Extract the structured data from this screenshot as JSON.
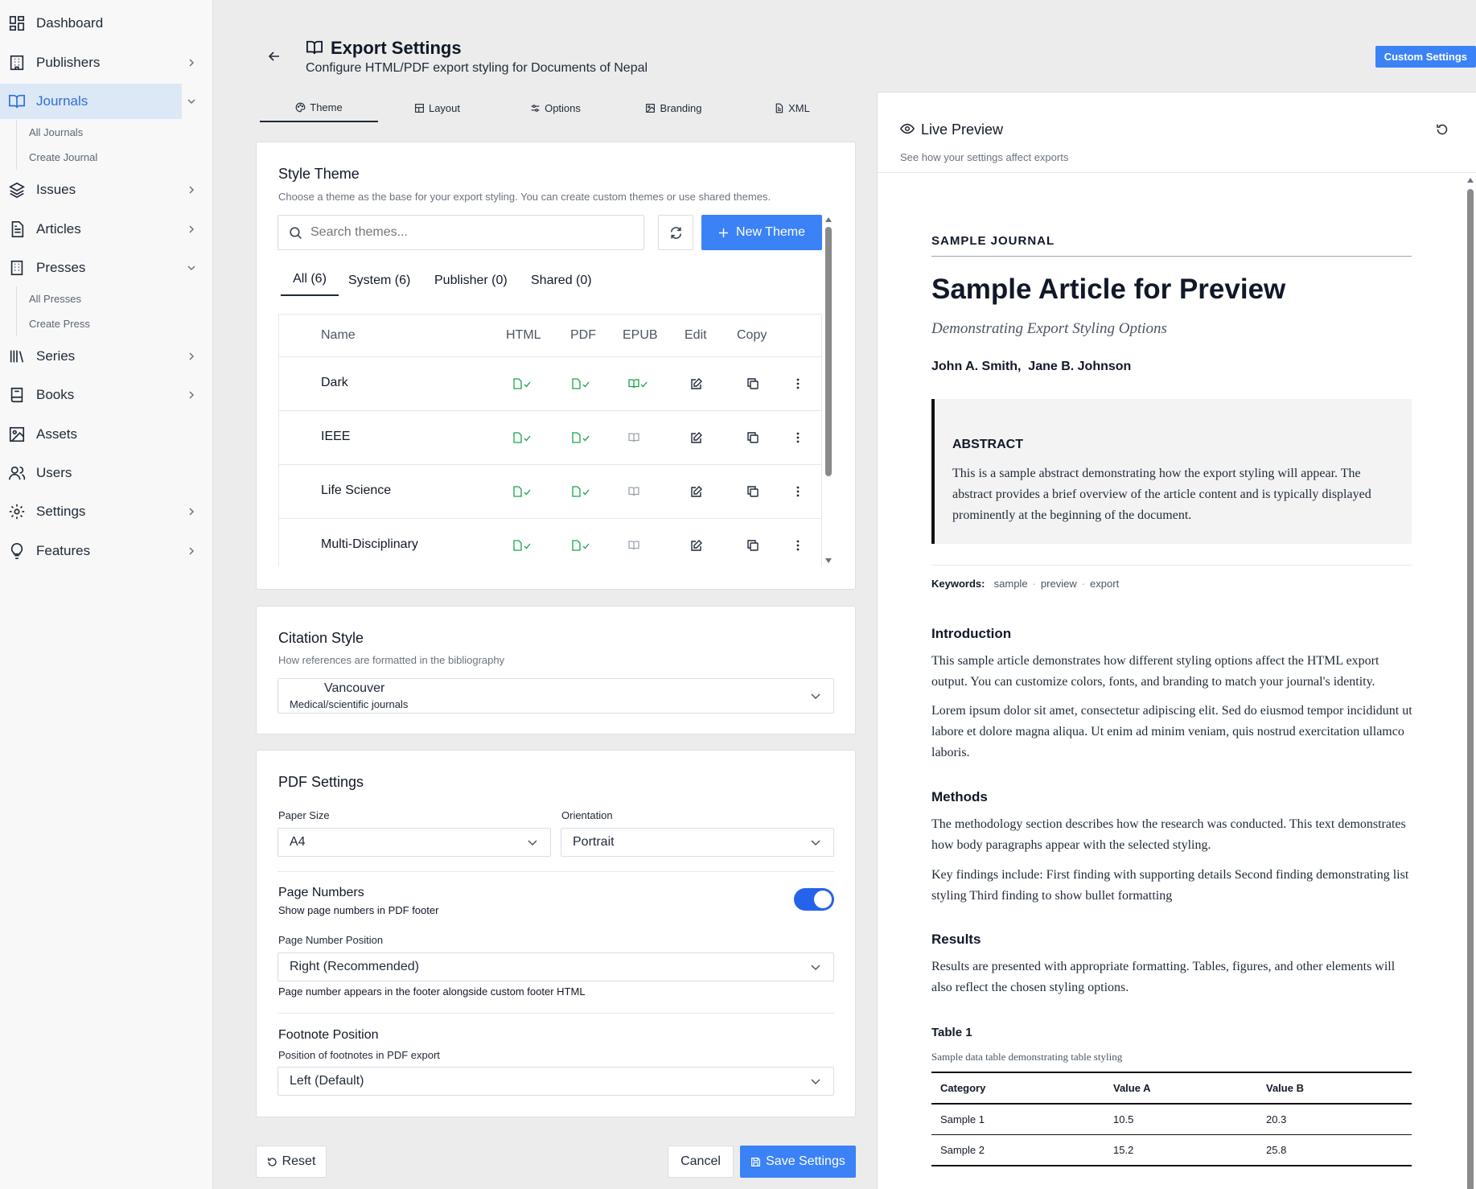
{
  "sidebar": {
    "items": [
      {
        "label": "Dashboard"
      },
      {
        "label": "Publishers"
      },
      {
        "label": "Journals"
      },
      {
        "label": "Issues"
      },
      {
        "label": "Articles"
      },
      {
        "label": "Presses"
      },
      {
        "label": "Series"
      },
      {
        "label": "Books"
      },
      {
        "label": "Assets"
      },
      {
        "label": "Users"
      },
      {
        "label": "Settings"
      },
      {
        "label": "Features"
      }
    ],
    "journals_sub": [
      "All Journals",
      "Create Journal"
    ],
    "presses_sub": [
      "All Presses",
      "Create Press"
    ]
  },
  "header": {
    "title": "Export Settings",
    "subtitle": "Configure HTML/PDF export styling for Documents of Nepal",
    "custom_settings_label": "Custom Settings"
  },
  "tabs": [
    {
      "label": "Theme",
      "icon": "palette-icon",
      "active": true
    },
    {
      "label": "Layout",
      "icon": "layout-icon"
    },
    {
      "label": "Options",
      "icon": "sliders-icon"
    },
    {
      "label": "Branding",
      "icon": "image-icon"
    },
    {
      "label": "XML",
      "icon": "file-code-icon"
    }
  ],
  "style_theme": {
    "title": "Style Theme",
    "description": "Choose a theme as the base for your export styling. You can create custom themes or use shared themes.",
    "search_placeholder": "Search themes...",
    "new_theme_label": "New Theme",
    "filters": [
      "All (6)",
      "System (6)",
      "Publisher (0)",
      "Shared (0)"
    ],
    "columns": [
      "Name",
      "HTML",
      "PDF",
      "EPUB",
      "Edit",
      "Copy"
    ],
    "rows": [
      {
        "name": "Dark",
        "html": true,
        "pdf": true,
        "epub": true
      },
      {
        "name": "IEEE",
        "html": true,
        "pdf": true,
        "epub": false
      },
      {
        "name": "Life Science",
        "html": true,
        "pdf": true,
        "epub": false
      },
      {
        "name": "Multi-Disciplinary",
        "html": true,
        "pdf": true,
        "epub": false
      }
    ]
  },
  "citation": {
    "title": "Citation Style",
    "description": "How references are formatted in the bibliography",
    "value": "Vancouver",
    "value_desc": "Medical/scientific journals"
  },
  "pdf": {
    "title": "PDF Settings",
    "paper_size_label": "Paper Size",
    "paper_size": "A4",
    "orientation_label": "Orientation",
    "orientation": "Portrait",
    "page_numbers_label": "Page Numbers",
    "page_numbers_desc": "Show page numbers in PDF footer",
    "page_numbers_on": true,
    "page_number_position_label": "Page Number Position",
    "page_number_position": "Right (Recommended)",
    "page_number_position_help": "Page number appears in the footer alongside custom footer HTML",
    "footnote_position_label": "Footnote Position",
    "footnote_position_desc": "Position of footnotes in PDF export",
    "footnote_position": "Left (Default)"
  },
  "actions": {
    "reset": "Reset",
    "cancel": "Cancel",
    "save": "Save Settings"
  },
  "preview": {
    "title": "Live Preview",
    "subtitle": "See how your settings affect exports",
    "journal": "SAMPLE JOURNAL",
    "article_title": "Sample Article for Preview",
    "article_subtitle": "Demonstrating Export Styling Options",
    "authors": [
      "John A. Smith,",
      "Jane B. Johnson"
    ],
    "abstract_heading": "ABSTRACT",
    "abstract": "This is a sample abstract demonstrating how the export styling will appear. The abstract provides a brief overview of the article content and is typically displayed prominently at the beginning of the document.",
    "keywords_label": "Keywords:",
    "keywords": [
      "sample",
      "preview",
      "export"
    ],
    "sections": [
      {
        "heading": "Introduction",
        "paragraphs": [
          "This sample article demonstrates how different styling options affect the HTML export output. You can customize colors, fonts, and branding to match your journal's identity.",
          "Lorem ipsum dolor sit amet, consectetur adipiscing elit. Sed do eiusmod tempor incididunt ut labore et dolore magna aliqua. Ut enim ad minim veniam, quis nostrud exercitation ullamco laboris."
        ]
      },
      {
        "heading": "Methods",
        "paragraphs": [
          "The methodology section describes how the research was conducted. This text demonstrates how body paragraphs appear with the selected styling.",
          "Key findings include: First finding with supporting details Second finding demonstrating list styling Third finding to show bullet formatting"
        ]
      },
      {
        "heading": "Results",
        "paragraphs": [
          "Results are presented with appropriate formatting. Tables, figures, and other elements will also reflect the chosen styling options."
        ]
      }
    ],
    "table": {
      "label": "Table 1",
      "caption": "Sample data table demonstrating table styling",
      "headers": [
        "Category",
        "Value A",
        "Value B"
      ],
      "rows": [
        [
          "Sample 1",
          "10.5",
          "20.3"
        ],
        [
          "Sample 2",
          "15.2",
          "25.8"
        ]
      ]
    }
  },
  "colors": {
    "accent": "#3b82f6",
    "html_green": "#16a34a",
    "active_nav": "#2f6fd8"
  }
}
